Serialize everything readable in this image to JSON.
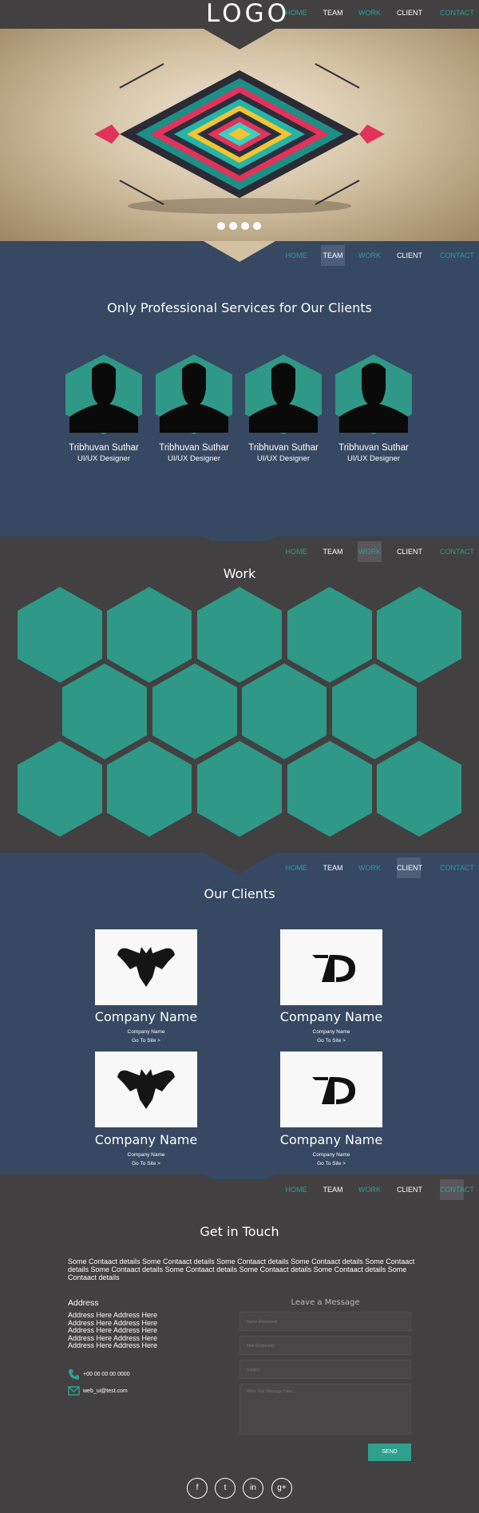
{
  "header": {
    "logo": "LOGO",
    "nav": [
      "HOME",
      "TEAM",
      "WORK",
      "CLIENT",
      "CONTACT"
    ]
  },
  "hero": {
    "slides": 4
  },
  "team": {
    "title": "Only Professional Services for Our Clients",
    "members": [
      {
        "name": "Tribhuvan Suthar",
        "role": "UI/UX Designer"
      },
      {
        "name": "Tribhuvan Suthar",
        "role": "UI/UX Designer"
      },
      {
        "name": "Tribhuvan Suthar",
        "role": "UI/UX Designer"
      },
      {
        "name": "Tribhuvan Suthar",
        "role": "UI/UX Designer"
      }
    ]
  },
  "work": {
    "title": "Work"
  },
  "clients": {
    "title": "Our Clients",
    "items": [
      {
        "name": "Company Name",
        "sub": "Company Name",
        "link": "Go To Site >",
        "logo": "bat-emblem"
      },
      {
        "name": "Company Name",
        "sub": "Company Name",
        "link": "Go To Site >",
        "logo": "ad-monogram"
      },
      {
        "name": "Company Name",
        "sub": "Company Name",
        "link": "Go To Site >",
        "logo": "bat-emblem"
      },
      {
        "name": "Company Name",
        "sub": "Company Name",
        "link": "Go To Site >",
        "logo": "ad-monogram"
      }
    ]
  },
  "contact": {
    "title": "Get in Touch",
    "text": "Some Contaact details Some Contaact details Some Contaact details Some Contaact details Some Contaact details Some Contaact details Some Contaact details Some Contaact details Some Contaact details Some Contaact details",
    "address_title": "Address",
    "address_lines": [
      "Address Here Address Here",
      "Address Here Address Here",
      "Address Here Address Here",
      "Address Here Address Here",
      "Address Here Address Here"
    ],
    "phone": "+00 00 00 00 0000",
    "email": "web_ui@test.com",
    "form_title": "Leave a Message",
    "placeholders": {
      "name": "Name (Required)",
      "mail": "Mail (Required)",
      "subject": "Subject",
      "message": "Write Your Message Here..."
    },
    "send": "SEND"
  },
  "social": [
    "f",
    "t",
    "in",
    "g+"
  ],
  "colors": {
    "accent": "#2fa08c",
    "blue_section": "#364862",
    "dark_section": "#424041"
  }
}
